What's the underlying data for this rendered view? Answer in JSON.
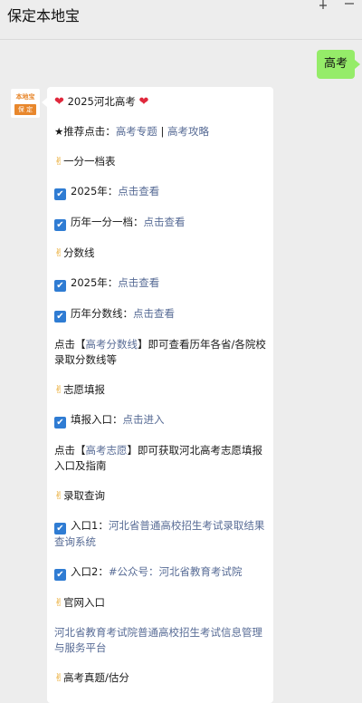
{
  "window": {
    "title": "保定本地宝"
  },
  "outgoing": {
    "text": "高考"
  },
  "avatar": {
    "top_text": "本地宝",
    "bottom_text": "保 定"
  },
  "message": {
    "headline": "2025河北高考",
    "recommend": {
      "prefix": "★推荐点击：",
      "link1": "高考专题",
      "sep": " | ",
      "link2": "高考攻略"
    },
    "section1": "一分一档表",
    "s1_item1": {
      "label": "2025年：",
      "link": "点击查看"
    },
    "s1_item2": {
      "label": "历年一分一档：",
      "link": "点击查看"
    },
    "section2": "分数线",
    "s2_item1": {
      "label": "2025年：",
      "link": "点击查看"
    },
    "s2_item2": {
      "label": "历年分数线：",
      "link": "点击查看"
    },
    "para1": {
      "prefix": "点击【",
      "link": "高考分数线",
      "suffix": "】即可查看历年各省/各院校录取分数线等"
    },
    "section3": "志愿填报",
    "s3_item1": {
      "label": "填报入口：",
      "link": "点击进入"
    },
    "para2": {
      "prefix": "点击【",
      "link": "高考志愿",
      "suffix": "】即可获取河北高考志愿填报入口及指南"
    },
    "section4": "录取查询",
    "s4_item1": {
      "label": "入口1：",
      "link": "河北省普通高校招生考试录取结果查询系统"
    },
    "s4_item2": {
      "label": "入口2：",
      "link": "#公众号：河北省教育考试院"
    },
    "section5": "官网入口",
    "s5_link": "河北省教育考试院普通高校招生考试信息管理与服务平台",
    "section6": "高考真题/估分"
  },
  "icons": {
    "heart": "heart-icon",
    "check": "check-box-icon",
    "hand": "victory-hand-icon",
    "pin": "pin-icon",
    "minimize": "minimize-icon"
  },
  "colors": {
    "link": "#576b95",
    "outgoing_bubble": "#95ec69",
    "background": "#ededed",
    "check": "#2f7cd3"
  }
}
